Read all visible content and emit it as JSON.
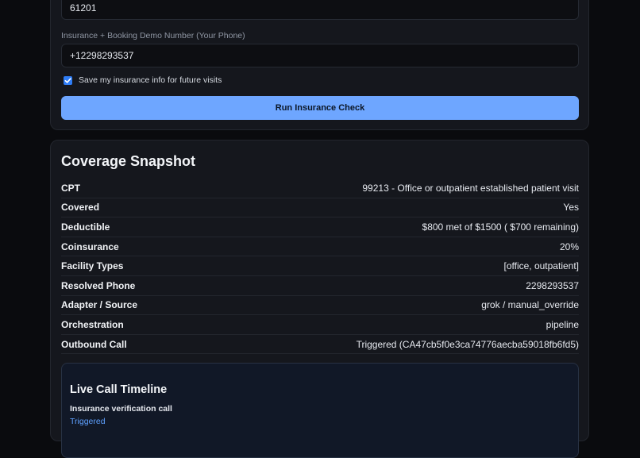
{
  "form": {
    "zip_value": "61201",
    "phone_label": "Insurance + Booking Demo Number (Your Phone)",
    "phone_value": "+12298293537",
    "save_checkbox_label": "Save my insurance info for future visits",
    "save_checked": true,
    "run_button_label": "Run Insurance Check"
  },
  "coverage": {
    "title": "Coverage Snapshot",
    "rows": [
      {
        "key": "CPT",
        "value": "99213 - Office or outpatient established patient visit"
      },
      {
        "key": "Covered",
        "value": "Yes"
      },
      {
        "key": "Deductible",
        "value": "$800 met of $1500 ( $700 remaining)"
      },
      {
        "key": "Coinsurance",
        "value": "20%"
      },
      {
        "key": "Facility Types",
        "value": "[office, outpatient]"
      },
      {
        "key": "Resolved Phone",
        "value": "2298293537"
      },
      {
        "key": "Adapter / Source",
        "value": "grok / manual_override"
      },
      {
        "key": "Orchestration",
        "value": "pipeline"
      },
      {
        "key": "Outbound Call",
        "value": "Triggered (CA47cb5f0e3ca74776aecba59018fb6fd5)"
      }
    ]
  },
  "timeline": {
    "title": "Live Call Timeline",
    "item_title": "Insurance verification call",
    "item_status": "Triggered"
  },
  "colors": {
    "accent_button": "#6ea6ff",
    "checkbox": "#2f7df6",
    "status_link": "#5ea0ff"
  }
}
